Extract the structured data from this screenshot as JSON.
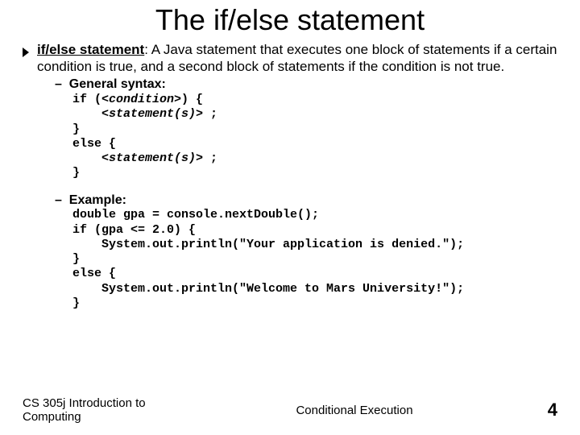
{
  "title": "The if/else statement",
  "definition": {
    "term": "if/else statement",
    "desc": ": A Java statement that executes one block of statements if a certain condition is true, and a second block of statements if the condition is not true."
  },
  "syntax": {
    "heading": "General syntax:",
    "l1a": "if (",
    "l1b": "<condition>",
    "l1c": ") {",
    "l2a": "    ",
    "l2b": "<statement(s)>",
    "l2c": " ;",
    "l3": "}",
    "l4": "else {",
    "l5a": "    ",
    "l5b": "<statement(s)>",
    "l5c": " ;",
    "l6": "}"
  },
  "example": {
    "heading": "Example:",
    "l1": "double gpa = console.nextDouble();",
    "l2": "if (gpa <= 2.0) {",
    "l3": "    System.out.println(\"Your application is denied.\");",
    "l4": "}",
    "l5": "else {",
    "l6": "    System.out.println(\"Welcome to Mars University!\");",
    "l7": "}"
  },
  "footer": {
    "left": "CS 305j Introduction to Computing",
    "center": "Conditional Execution",
    "page": "4"
  }
}
